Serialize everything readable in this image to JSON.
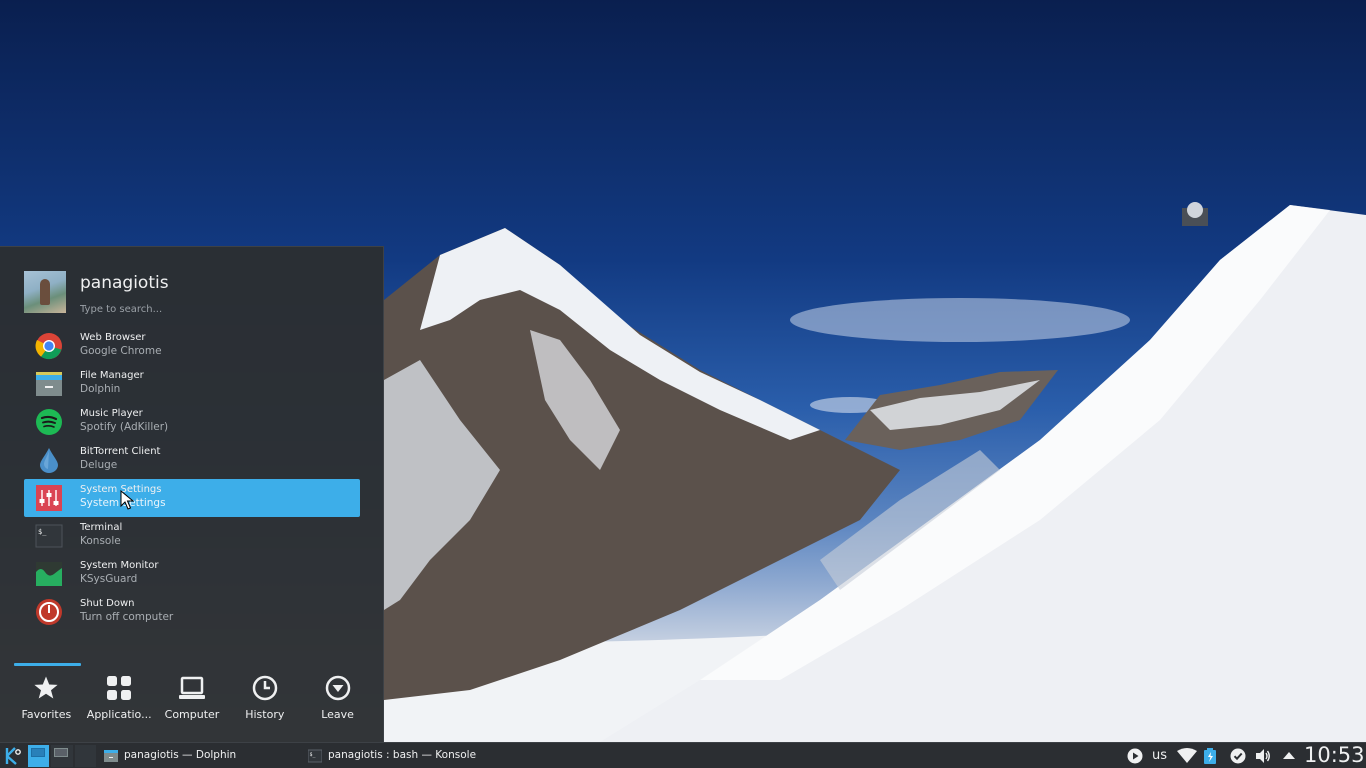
{
  "launcher": {
    "username": "panagiotis",
    "search_placeholder": "Type to search...",
    "favorites": [
      {
        "title": "Web Browser",
        "subtitle": "Google Chrome",
        "icon": "chrome-icon"
      },
      {
        "title": "File Manager",
        "subtitle": "Dolphin",
        "icon": "folder-icon"
      },
      {
        "title": "Music Player",
        "subtitle": "Spotify (AdKiller)",
        "icon": "spotify-icon"
      },
      {
        "title": "BitTorrent Client",
        "subtitle": "Deluge",
        "icon": "deluge-icon"
      },
      {
        "title": "System Settings",
        "subtitle": "System Settings",
        "icon": "settings-icon",
        "active": true
      },
      {
        "title": "Terminal",
        "subtitle": "Konsole",
        "icon": "terminal-icon"
      },
      {
        "title": "System Monitor",
        "subtitle": "KSysGuard",
        "icon": "monitor-icon"
      },
      {
        "title": "Shut Down",
        "subtitle": "Turn off computer",
        "icon": "power-icon"
      }
    ],
    "tabs": [
      {
        "label": "Favorites",
        "icon": "star-icon",
        "active": true
      },
      {
        "label": "Applicatio...",
        "icon": "grid-icon"
      },
      {
        "label": "Computer",
        "icon": "laptop-icon"
      },
      {
        "label": "History",
        "icon": "clock-icon"
      },
      {
        "label": "Leave",
        "icon": "leave-icon"
      }
    ]
  },
  "taskbar": {
    "tasks": [
      {
        "label": "panagiotis — Dolphin",
        "icon": "folder-icon"
      },
      {
        "label": "panagiotis : bash — Konsole",
        "icon": "terminal-icon"
      }
    ],
    "keyboard_layout": "us",
    "clock": "10:53"
  },
  "colors": {
    "accent": "#3daee9",
    "panel": "#2b2e32"
  }
}
